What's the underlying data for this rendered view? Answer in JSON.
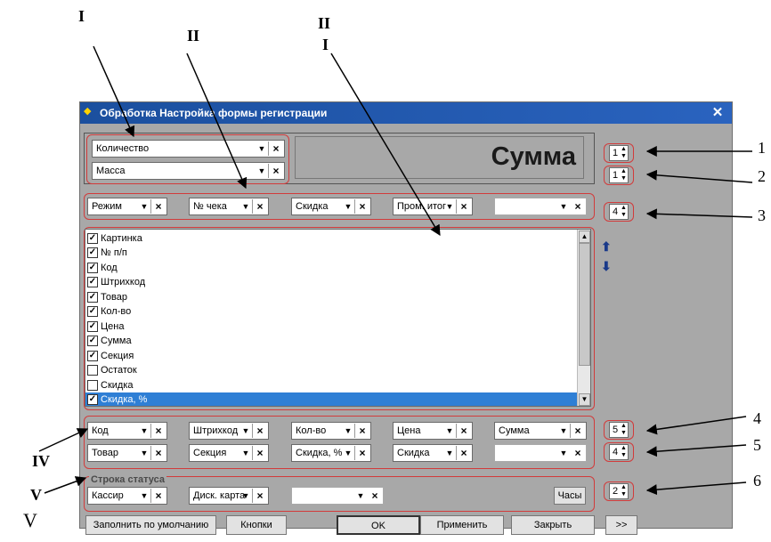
{
  "annotations": {
    "roman_top_left": "I",
    "roman_top_mid": "II",
    "roman_top_right_1": "II",
    "roman_top_right_2": "I",
    "roman_iv": "IV",
    "roman_v": "V",
    "roman_v2": "V",
    "numbers": [
      "1",
      "2",
      "3",
      "4",
      "5",
      "6"
    ]
  },
  "window": {
    "title": "Обработка  Настройка формы регистрации",
    "close_glyph": "✕"
  },
  "top_group": {
    "combo1": "Количество",
    "combo2": "Масса",
    "display_text": "Сумма"
  },
  "row_header": [
    "Режим",
    "№ чека",
    "Скидка",
    "Пром. итог",
    ""
  ],
  "list": {
    "items": [
      {
        "label": "Картинка",
        "checked": true
      },
      {
        "label": "№ п/п",
        "checked": true
      },
      {
        "label": "Код",
        "checked": true
      },
      {
        "label": "Штрихкод",
        "checked": true
      },
      {
        "label": "Товар",
        "checked": true
      },
      {
        "label": "Кол-во",
        "checked": true
      },
      {
        "label": "Цена",
        "checked": true
      },
      {
        "label": "Сумма",
        "checked": true
      },
      {
        "label": "Секция",
        "checked": true
      },
      {
        "label": "Остаток",
        "checked": false
      },
      {
        "label": "Скидка",
        "checked": false
      },
      {
        "label": "Скидка, %",
        "checked": true,
        "selected": true
      }
    ]
  },
  "row_columns_1": [
    "Код",
    "Штрихкод",
    "Кол-во",
    "Цена",
    "Сумма"
  ],
  "row_columns_2": [
    "Товар",
    "Секция",
    "Скидка, %",
    "Скидка",
    ""
  ],
  "status": {
    "legend": "Строка статуса",
    "items": [
      "Кассир",
      "Диск. карта",
      ""
    ],
    "clock_button": "Часы"
  },
  "spinners": [
    "1",
    "1",
    "4",
    "5",
    "4",
    "2"
  ],
  "buttons": {
    "defaults": "Заполнить по умолчанию",
    "buttons": "Кнопки",
    "ok": "OK",
    "apply": "Применить",
    "close": "Закрыть",
    "more": ">>"
  },
  "colors": {
    "titlebar": "#2a63bf",
    "highlight": "#2f7fd5",
    "annotation_box": "#d23b3b"
  }
}
